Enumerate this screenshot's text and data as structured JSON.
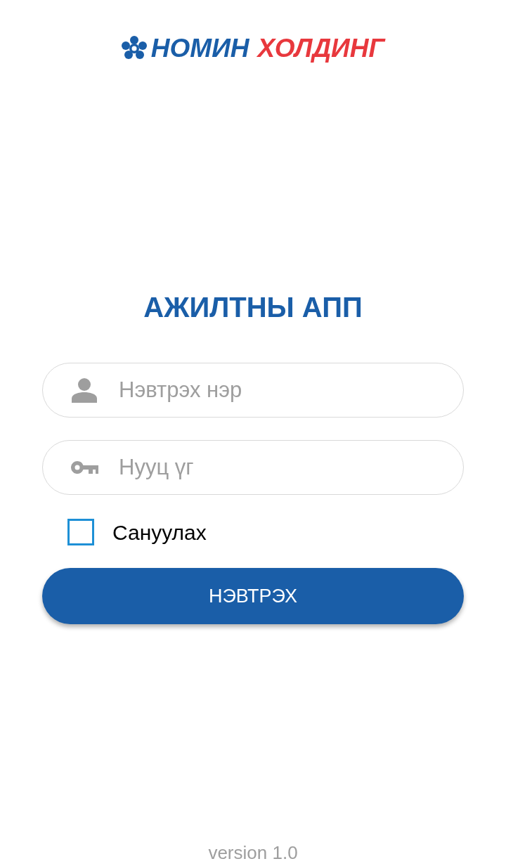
{
  "logo": {
    "first_word": "НОМИН",
    "second_word": "ХОЛДИНГ"
  },
  "title": "АЖИЛТНЫ АПП",
  "fields": [
    {
      "kind": "user",
      "placeholder": "Нэвтрэх нэр"
    },
    {
      "kind": "password",
      "placeholder": "Нууц үг"
    }
  ],
  "remember": {
    "label": "Сануулах",
    "checked": false
  },
  "login_button": "НЭВТРЭХ",
  "version": "version 1.0"
}
